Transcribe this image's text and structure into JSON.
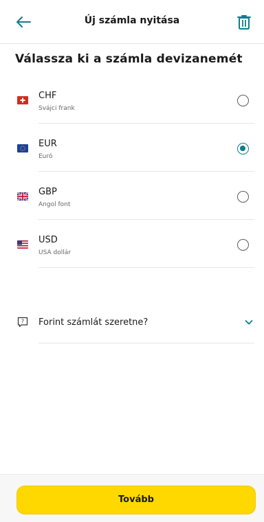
{
  "header": {
    "title": "Új számla nyitása",
    "back_icon": "arrow-left-icon",
    "delete_icon": "trash-icon",
    "accent_color": "#0b7e8c"
  },
  "main": {
    "title": "Válassza ki a számla devizanemét",
    "currencies": [
      {
        "code": "CHF",
        "name": "Svájci frank",
        "flag": "swiss-flag-icon",
        "selected": false
      },
      {
        "code": "EUR",
        "name": "Euró",
        "flag": "eu-flag-icon",
        "selected": true
      },
      {
        "code": "GBP",
        "name": "Angol font",
        "flag": "uk-flag-icon",
        "selected": false
      },
      {
        "code": "USD",
        "name": "USA dollár",
        "flag": "us-flag-icon",
        "selected": false
      }
    ]
  },
  "faq": {
    "question": "Forint számlát szeretne?",
    "icon": "question-speech-icon",
    "chevron": "chevron-down-icon"
  },
  "footer": {
    "continue_label": "Tovább",
    "button_color": "#ffd800"
  }
}
